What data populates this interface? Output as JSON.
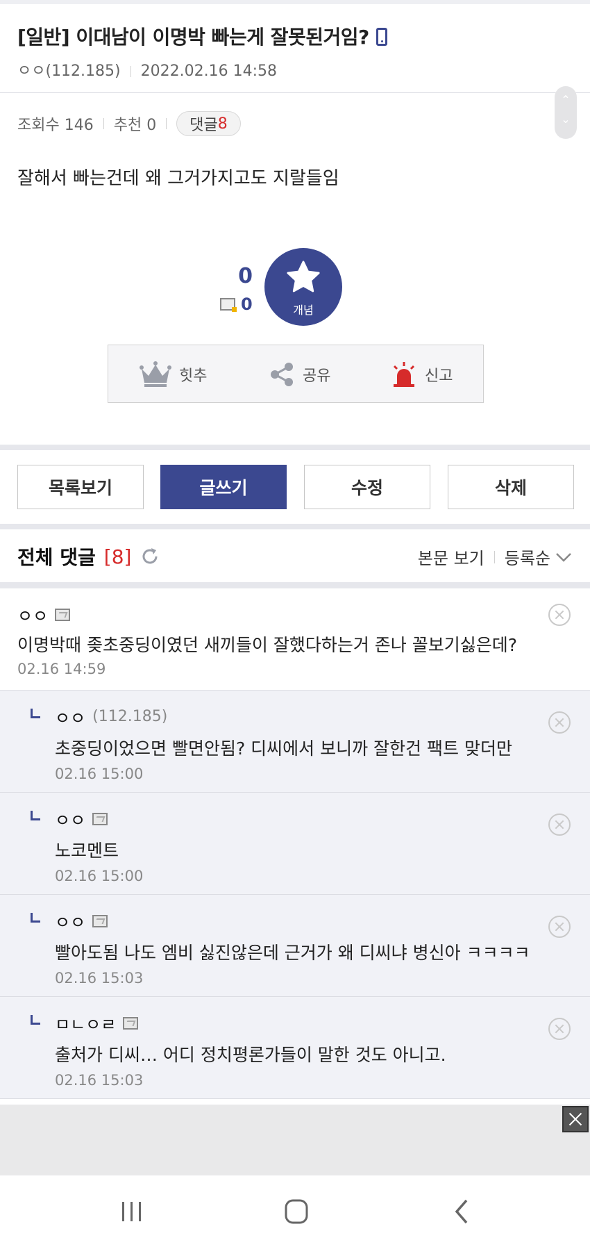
{
  "post": {
    "title": "[일반] 이대남이 이명박 빠는게 잘못된거임?",
    "author": "ㅇㅇ(112.185)",
    "date": "2022.02.16 14:58",
    "views_label": "조회수 146",
    "recommend_label": "추천 0",
    "comment_badge_label": "댓글",
    "comment_badge_count": "8",
    "body": "잘해서 빠는건데 왜 그거가지고도 지랄들임"
  },
  "recommend": {
    "count": "0",
    "fixed_count": "0",
    "star_label": "개념"
  },
  "actions": {
    "hitchu": "힛추",
    "share": "공유",
    "report": "신고"
  },
  "buttons": {
    "list": "목록보기",
    "write": "글쓰기",
    "edit": "수정",
    "delete": "삭제"
  },
  "comments_header": {
    "title": "전체 댓글",
    "count": "[8]",
    "view_body": "본문 보기",
    "sort": "등록순"
  },
  "comments": [
    {
      "name": "ㅇㅇ",
      "ip": "",
      "text": "이명박때 좆초중딩이였던 새끼들이 잘했다하는거 존나 꼴보기싫은데?",
      "date": "02.16 14:59"
    },
    {
      "name": "ㅇㅇ",
      "ip": "(112.185)",
      "text": "초중딩이었으면 빨면안됨? 디씨에서 보니까 잘한건 팩트 맞더만",
      "date": "02.16 15:00"
    },
    {
      "name": "ㅇㅇ",
      "ip": "",
      "text": "노코멘트",
      "date": "02.16 15:00"
    },
    {
      "name": "ㅇㅇ",
      "ip": "",
      "text": "빨아도됨 나도 엠비 싫진않은데 근거가 왜 디씨냐 병신아 ㅋㅋㅋㅋ",
      "date": "02.16 15:03"
    },
    {
      "name": "ㅁㄴㅇㄹ",
      "ip": "",
      "text": "출처가 디씨… 어디 정치평론가들이 말한 것도 아니고.",
      "date": "02.16 15:03"
    }
  ],
  "colors": {
    "brand": "#3b4890",
    "accent_red": "#d62b2b",
    "reply_bg": "#f1f2f7"
  }
}
